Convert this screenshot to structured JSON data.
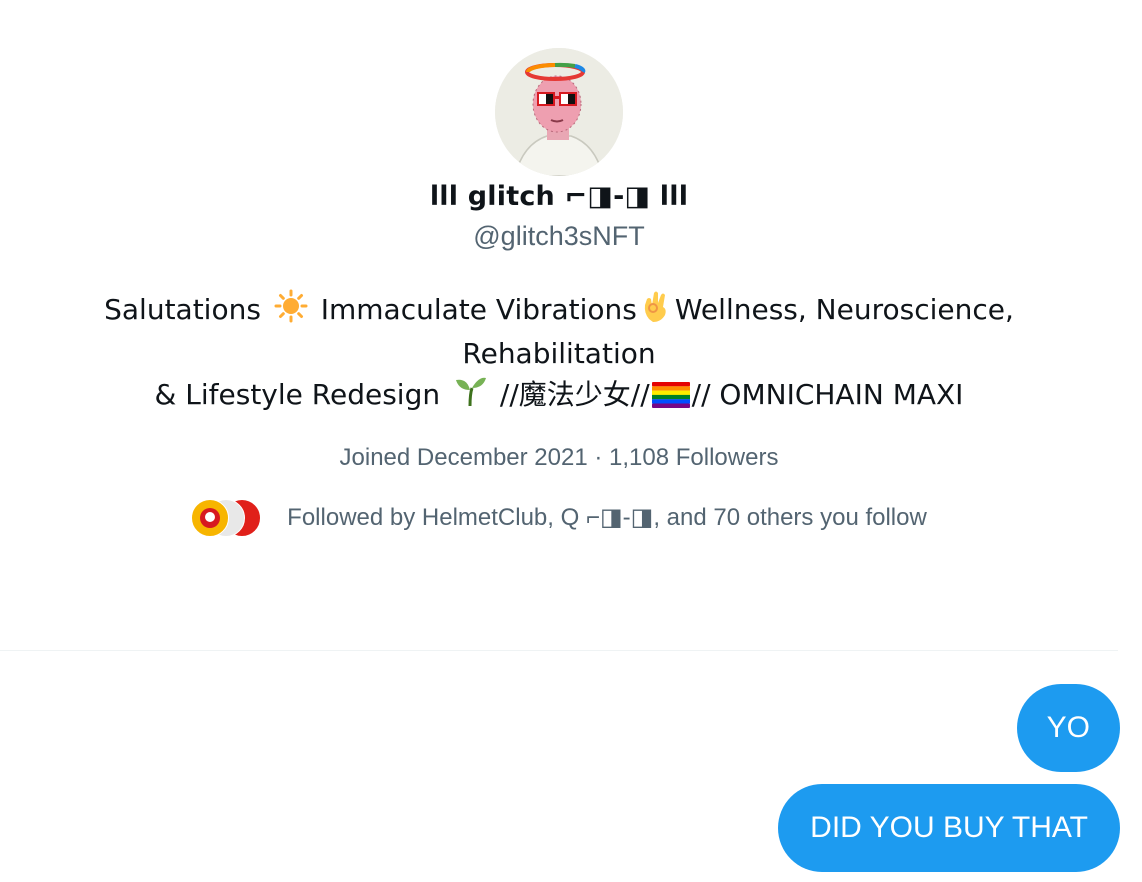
{
  "profile": {
    "display_name": "lll glitch ⌐◨-◨ lll",
    "handle": "@glitch3sNFT",
    "bio_line1_a": "Salutations",
    "bio_line1_b": "Immaculate Vibrations",
    "bio_line1_c": "Wellness, Neuroscience, Rehabilitation",
    "bio_line2_a": "& Lifestyle Redesign",
    "bio_line2_b": "//魔法少女//",
    "bio_line2_c": "// OMNICHAIN MAXI",
    "joined": "Joined December 2021",
    "separator": "·",
    "followers": "1,108 Followers",
    "followed_by": "Followed by HelmetClub, Q ⌐◨-◨, and 70 others you follow"
  },
  "icons": {
    "sun": "sun-emoji",
    "ok_hand": "ok-hand-emoji",
    "seedling": "seedling-emoji",
    "rainbow_flag": "rainbow-flag-emoji"
  },
  "colors": {
    "accent": "#1d9bf0",
    "secondary_text": "#536471",
    "primary_text": "#0f1419"
  },
  "messages": [
    {
      "text": "YO"
    },
    {
      "text": "DID YOU BUY THAT"
    }
  ]
}
